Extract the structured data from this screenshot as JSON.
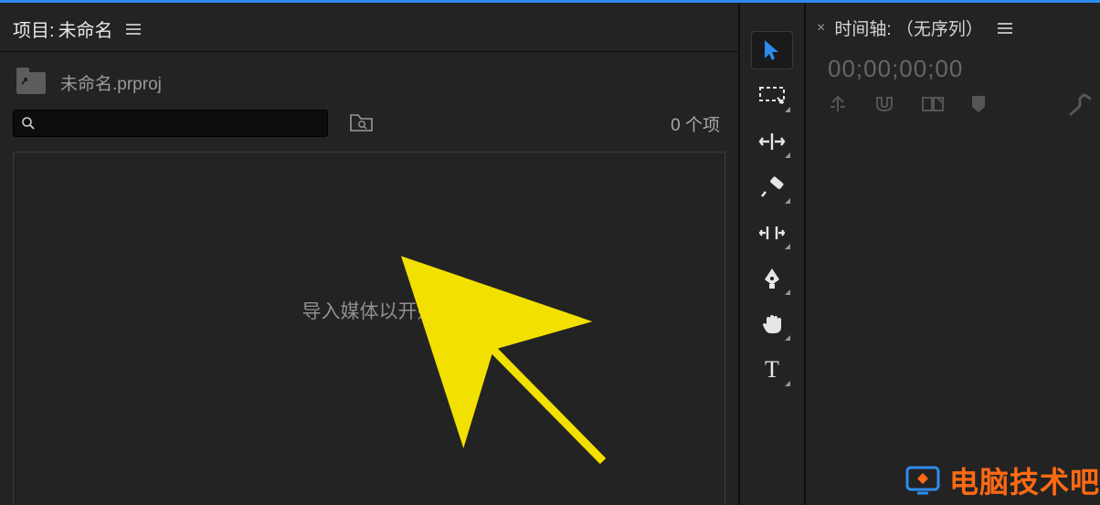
{
  "project": {
    "tab_prefix": "项目:",
    "tab_name": "未命名",
    "file_name": "未命名.prproj",
    "item_count": "0 个项",
    "drop_hint": "导入媒体以开始",
    "search_placeholder": ""
  },
  "timeline": {
    "tab_label": "时间轴: （无序列）",
    "timecode": "00;00;00;00"
  },
  "tools": [
    {
      "name": "selection-tool",
      "selected": true
    },
    {
      "name": "marquee-tool"
    },
    {
      "name": "ripple-edit-tool"
    },
    {
      "name": "razor-tool"
    },
    {
      "name": "slip-tool"
    },
    {
      "name": "pen-tool"
    },
    {
      "name": "hand-tool"
    },
    {
      "name": "type-tool"
    }
  ],
  "timeline_icons": [
    "snap-icon",
    "magnet-icon",
    "linked-selection-icon",
    "marker-icon",
    "settings-icon"
  ],
  "watermark": "电脑技术吧"
}
